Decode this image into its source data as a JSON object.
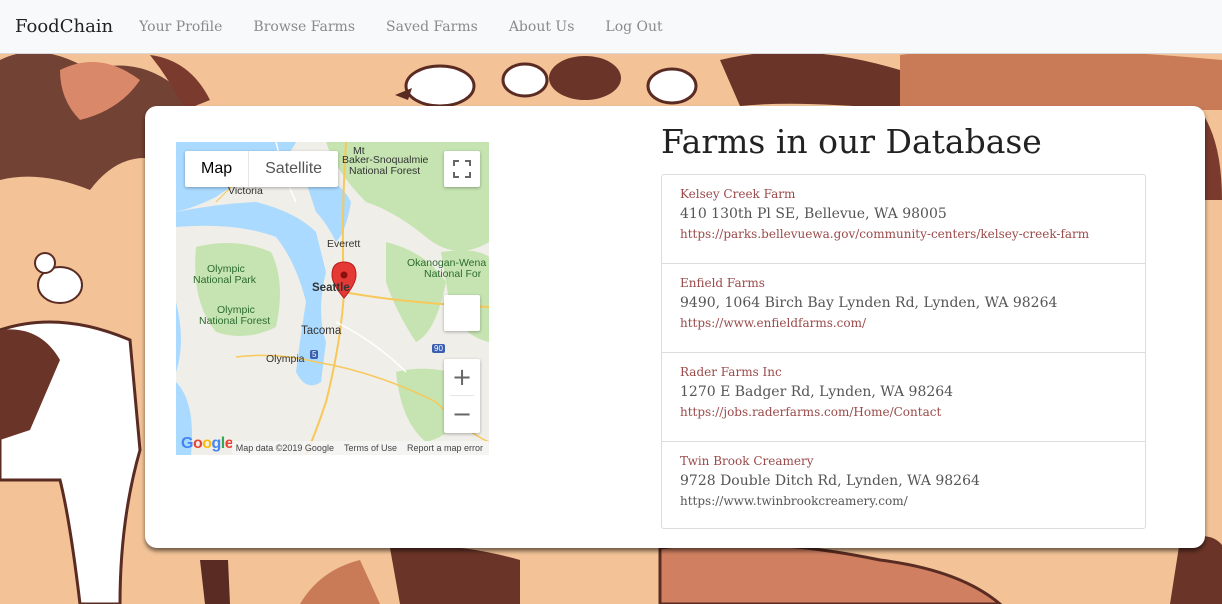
{
  "navbar": {
    "brand": "FoodChain",
    "links": [
      "Your Profile",
      "Browse Farms",
      "Saved Farms",
      "About Us",
      "Log Out"
    ]
  },
  "map": {
    "type_options": [
      "Map",
      "Satellite"
    ],
    "selected_type": "Map",
    "labels": {
      "mt_baker": "Mt",
      "baker_snoqualmie": "Baker-Snoqualmie",
      "national_forest_1": "National Forest",
      "victoria": "Victoria",
      "everett": "Everett",
      "okanogan": "Okanogan-Wena",
      "national_forest_2": "National For",
      "olympic_np_1": "Olympic",
      "olympic_np_2": "National Park",
      "seattle": "Seattle",
      "olympic_nf_1": "Olympic",
      "olympic_nf_2": "National Forest",
      "tacoma": "Tacoma",
      "olympia": "Olympia",
      "i5": "5",
      "i90": "90"
    },
    "footer": {
      "logo": "Google",
      "map_data": "Map data ©2019 Google",
      "terms": "Terms of Use",
      "report": "Report a map error"
    },
    "zoom_in": "+",
    "zoom_out": "−"
  },
  "main": {
    "heading": "Farms in our Database",
    "farms": [
      {
        "name": "Kelsey Creek Farm",
        "address": "410 130th Pl SE, Bellevue, WA 98005",
        "url": "https://parks.bellevuewa.gov/community-centers/kelsey-creek-farm"
      },
      {
        "name": "Enfield Farms",
        "address": "9490, 1064 Birch Bay Lynden Rd, Lynden, WA 98264",
        "url": "https://www.enfieldfarms.com/"
      },
      {
        "name": "Rader Farms Inc",
        "address": "1270 E Badger Rd, Lynden, WA 98264",
        "url": "https://jobs.raderfarms.com/Home/Contact"
      },
      {
        "name": "Twin Brook Creamery",
        "address": "9728 Double Ditch Rd, Lynden, WA 98264",
        "url": "https://www.twinbrookcreamery.com/"
      }
    ]
  },
  "colors": {
    "background": "#f3c397",
    "link": "#9a4a4a",
    "marker": "#e53935"
  }
}
